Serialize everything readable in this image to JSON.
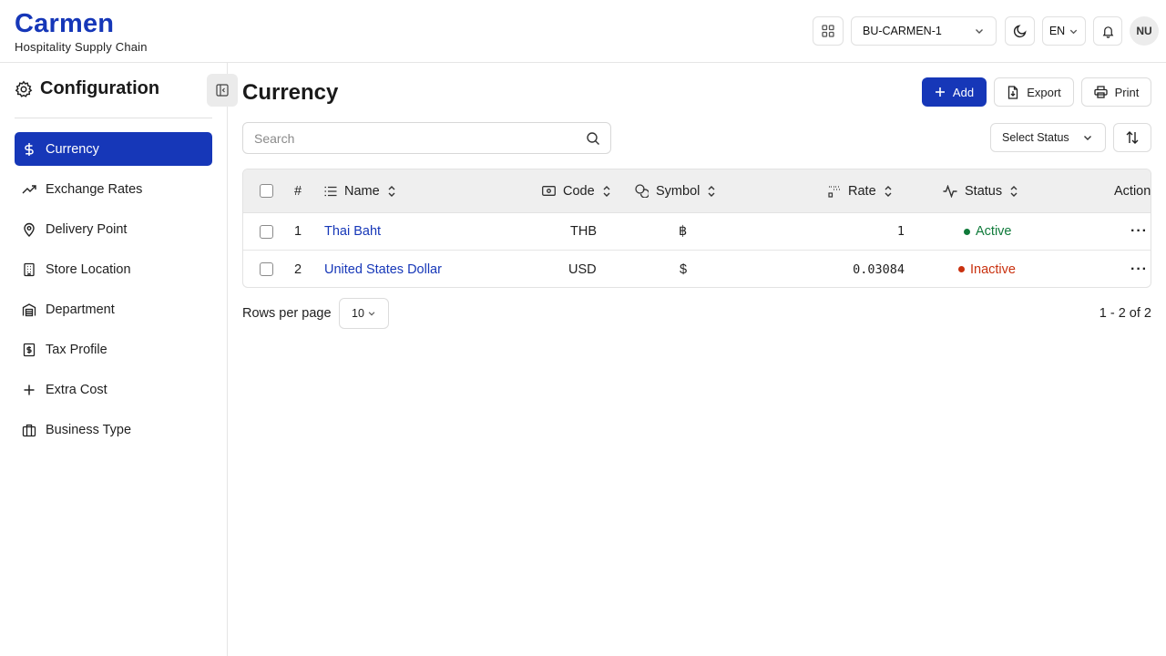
{
  "brand": {
    "title": "Carmen",
    "subtitle": "Hospitality Supply Chain"
  },
  "header": {
    "apps_icon": "grid-icon",
    "business_unit": "BU-CARMEN-1",
    "theme_icon": "moon-icon",
    "language": "EN",
    "notification_icon": "bell-icon",
    "avatar_initials": "NU"
  },
  "sidebar": {
    "title": "Configuration",
    "title_icon": "gear-icon",
    "items": [
      {
        "label": "Currency",
        "icon": "dollar-icon",
        "active": true
      },
      {
        "label": "Exchange Rates",
        "icon": "trending-up-icon"
      },
      {
        "label": "Delivery Point",
        "icon": "map-pin-icon"
      },
      {
        "label": "Store Location",
        "icon": "building-icon"
      },
      {
        "label": "Department",
        "icon": "warehouse-icon"
      },
      {
        "label": "Tax Profile",
        "icon": "receipt-icon"
      },
      {
        "label": "Extra Cost",
        "icon": "plus-icon"
      },
      {
        "label": "Business Type",
        "icon": "briefcase-icon"
      }
    ]
  },
  "page": {
    "title": "Currency",
    "actions": {
      "add": "Add",
      "export": "Export",
      "print": "Print"
    },
    "search_placeholder": "Search",
    "status_filter": "Select Status"
  },
  "table": {
    "columns": {
      "index": "#",
      "name": "Name",
      "code": "Code",
      "symbol": "Symbol",
      "rate": "Rate",
      "status": "Status",
      "action": "Action"
    },
    "rows": [
      {
        "index": "1",
        "name": "Thai Baht",
        "code": "THB",
        "symbol": "฿",
        "rate": "1",
        "status": "Active"
      },
      {
        "index": "2",
        "name": "United States Dollar",
        "code": "USD",
        "symbol": "$",
        "rate": "0.03084",
        "status": "Inactive"
      }
    ]
  },
  "footer": {
    "rows_per_page_label": "Rows per page",
    "rows_per_page": "10",
    "range": "1 - 2 of 2"
  },
  "colors": {
    "primary": "#1637b8",
    "active": "#0f7a3a",
    "inactive": "#c9310f"
  }
}
